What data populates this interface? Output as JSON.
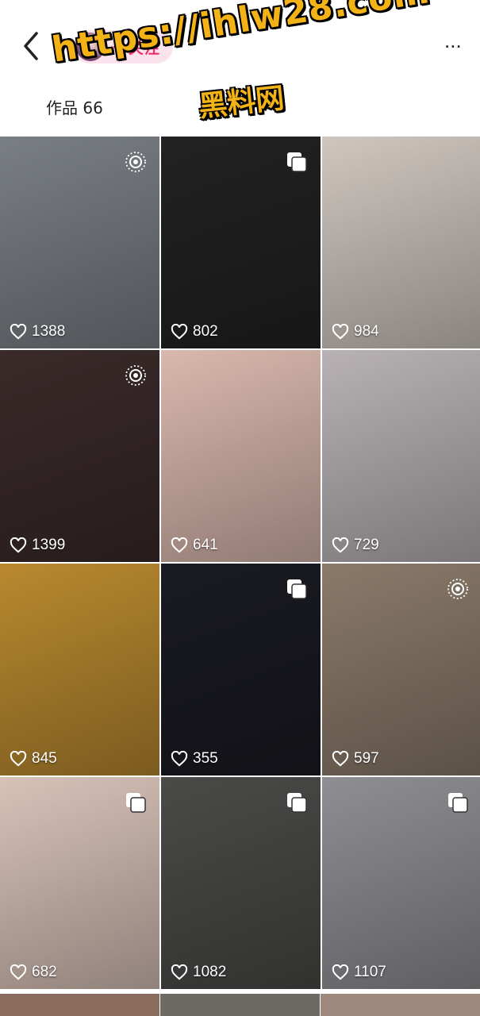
{
  "header": {
    "back_icon": "chevron-left-icon",
    "follow_label": "十关注",
    "more_label": "...",
    "works_label": "作品 66"
  },
  "watermark": {
    "url": "https://ihlw28.com",
    "cn": "黑料网"
  },
  "posts": [
    {
      "likes": "1388",
      "badge": "live-photo-icon",
      "bg": "#7a7f85"
    },
    {
      "likes": "802",
      "badge": "multi-image-icon",
      "bg": "#222222"
    },
    {
      "likes": "984",
      "badge": "",
      "bg": "#cfc6bf"
    },
    {
      "likes": "1399",
      "badge": "live-photo-icon",
      "bg": "#3a2a2a"
    },
    {
      "likes": "641",
      "badge": "",
      "bg": "#d9b8ad"
    },
    {
      "likes": "729",
      "badge": "",
      "bg": "#b8b2b5"
    },
    {
      "likes": "845",
      "badge": "",
      "bg": "#b9892f"
    },
    {
      "likes": "355",
      "badge": "multi-image-icon",
      "bg": "#1a1a22"
    },
    {
      "likes": "597",
      "badge": "live-photo-icon",
      "bg": "#8a7a6a"
    },
    {
      "likes": "682",
      "badge": "multi-image-icon",
      "bg": "#d8c2b8"
    },
    {
      "likes": "1082",
      "badge": "multi-image-icon",
      "bg": "#4a4a48"
    },
    {
      "likes": "1107",
      "badge": "multi-image-icon",
      "bg": "#8f8e93"
    }
  ]
}
